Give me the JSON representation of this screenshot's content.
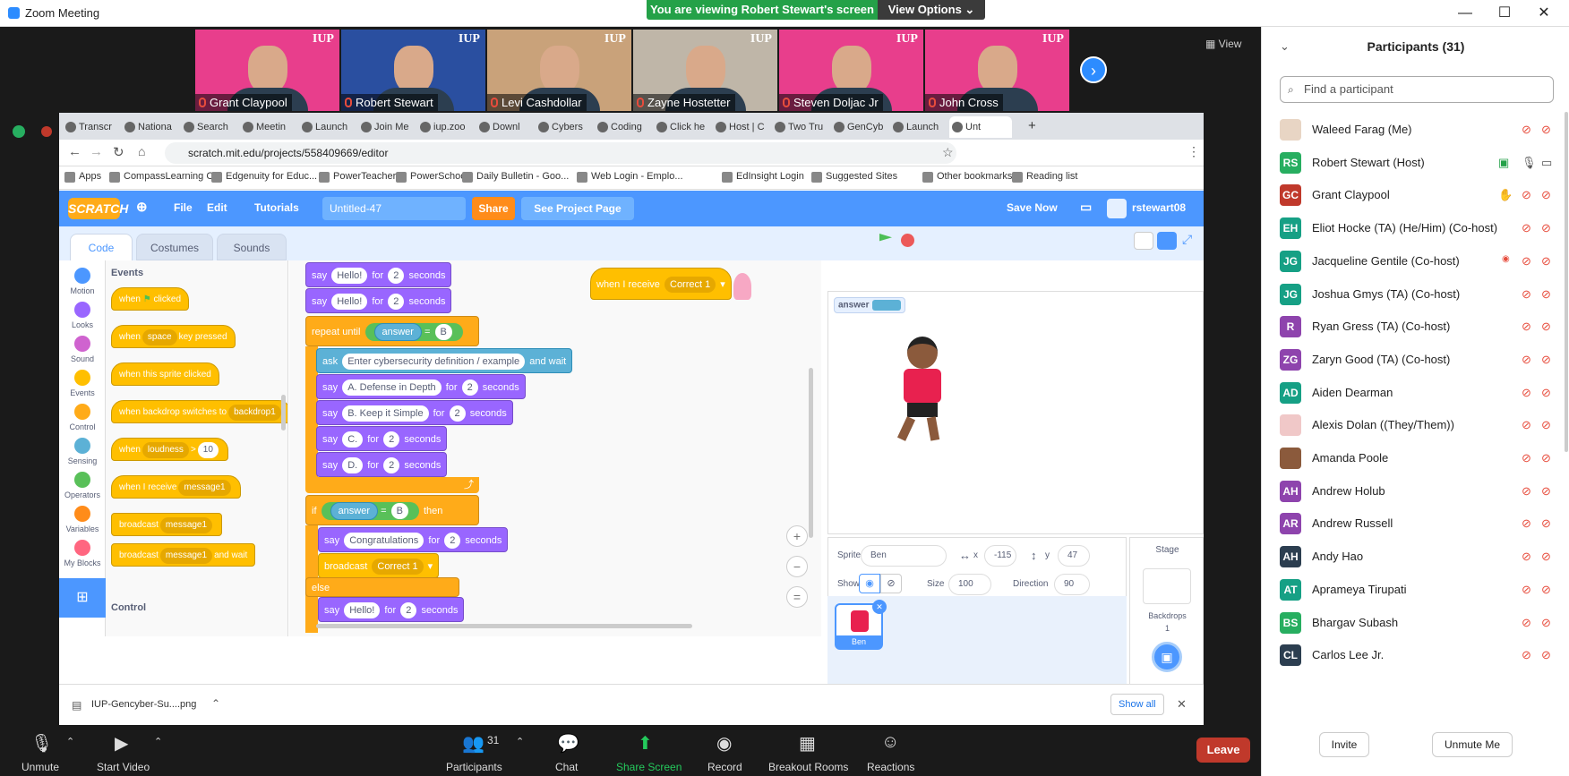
{
  "window": {
    "title": "Zoom Meeting",
    "viewing": "You are viewing Robert Stewart's screen",
    "view_options": "View Options",
    "view_label": "View"
  },
  "thumbs": [
    {
      "name": "Grant Claypool",
      "bg": "#e83e8c"
    },
    {
      "name": "Robert Stewart",
      "bg": "#2a4fa0"
    },
    {
      "name": "Levi Cashdollar",
      "bg": "#c9a27a"
    },
    {
      "name": "Zayne Hostetter",
      "bg": "#bfb6a8"
    },
    {
      "name": "Steven Doljac Jr",
      "bg": "#e83e8c"
    },
    {
      "name": "John Cross",
      "bg": "#e83e8c"
    }
  ],
  "iup": "IUP",
  "browser": {
    "tabs": [
      "Transcr",
      "Nationa",
      "Search",
      "Meetin",
      "Launch",
      "Join Me",
      "iup.zoo",
      "Downl",
      "Cybers",
      "Coding",
      "Click he",
      "Host | C",
      "Two Tru",
      "GenCyb",
      "Launch",
      "Unt"
    ],
    "url": "scratch.mit.edu/projects/558409669/editor",
    "bookmarks": [
      "Apps",
      "CompassLearning C...",
      "Edgenuity for Educ...",
      "PowerTeacher",
      "PowerSchool",
      "Daily Bulletin - Goo...",
      "Web Login - Emplo...",
      "EdInsight Login",
      "Suggested Sites",
      "Other bookmarks",
      "Reading list"
    ]
  },
  "scratch": {
    "logo": "SCRATCH",
    "file": "File",
    "edit": "Edit",
    "tutorials": "Tutorials",
    "project": "Untitled-47",
    "share": "Share",
    "see_page": "See Project Page",
    "save_now": "Save Now",
    "user": "rstewart08",
    "tabs": [
      "Code",
      "Costumes",
      "Sounds"
    ],
    "categories": [
      {
        "label": "Motion",
        "color": "#4c97ff"
      },
      {
        "label": "Looks",
        "color": "#9966ff"
      },
      {
        "label": "Sound",
        "color": "#cf63cf"
      },
      {
        "label": "Events",
        "color": "#ffbf00"
      },
      {
        "label": "Control",
        "color": "#ffab19"
      },
      {
        "label": "Sensing",
        "color": "#5cb1d6"
      },
      {
        "label": "Operators",
        "color": "#59c059"
      },
      {
        "label": "Variables",
        "color": "#ff8c1a"
      },
      {
        "label": "My Blocks",
        "color": "#ff6680"
      }
    ],
    "palette_heading": "Events",
    "palette_heading2": "Control",
    "palette": {
      "flag_a": "when",
      "flag_b": "clicked",
      "key_a": "when",
      "key_b": "space",
      "key_c": "key pressed",
      "sprite_click": "when this sprite clicked",
      "backdrop_a": "when backdrop switches to",
      "backdrop_b": "backdrop1",
      "loud_a": "when",
      "loud_b": "loudness",
      "loud_c": ">",
      "loud_d": "10",
      "recv_a": "when I receive",
      "recv_b": "message1",
      "bc_a": "broadcast",
      "bc_b": "message1",
      "bcw_a": "broadcast",
      "bcw_b": "message1",
      "bcw_c": "and wait"
    },
    "script": {
      "say": "say",
      "for": "for",
      "seconds": "seconds",
      "hello": "Hello!",
      "two": "2",
      "repeat_until": "repeat until",
      "answer": "answer",
      "eq": "=",
      "b": "B",
      "ask": "ask",
      "ask_text": "Enter cybersecurity definition / example",
      "and_wait": "and wait",
      "opt_a": "A. Defense in Depth",
      "opt_b": "B. Keep it Simple",
      "opt_c": "C.",
      "opt_d": "D.",
      "if": "if",
      "then": "then",
      "congrats": "Congratulations",
      "broadcast": "broadcast",
      "correct1": "Correct 1",
      "else": "else",
      "when_receive": "when I receive"
    },
    "monitor": "answer",
    "sprite": {
      "label": "Sprite",
      "name": "Ben",
      "x_label": "x",
      "x": "-115",
      "y_label": "y",
      "y": "47",
      "show": "Show",
      "size_label": "Size",
      "size": "100",
      "dir_label": "Direction",
      "dir": "90",
      "thumb": "Ben"
    },
    "stage": {
      "label": "Stage",
      "backdrops": "Backdrops",
      "count": "1"
    }
  },
  "download": {
    "file": "IUP-Gencyber-Su....png",
    "show_all": "Show all"
  },
  "participants": {
    "title": "Participants (31)",
    "search": "Find a participant",
    "list": [
      {
        "name": "Waleed Farag (Me)",
        "initials": "",
        "color": "#e8d5c4"
      },
      {
        "name": "Robert Stewart (Host)",
        "initials": "RS",
        "color": "#27ae60"
      },
      {
        "name": "Grant Claypool",
        "initials": "GC",
        "color": "#c0392b"
      },
      {
        "name": "Eliot Hocke (TA) (He/Him) (Co-host)",
        "initials": "EH",
        "color": "#16a085"
      },
      {
        "name": "Jacqueline Gentile (Co-host)",
        "initials": "JG",
        "color": "#16a085"
      },
      {
        "name": "Joshua Gmys (TA) (Co-host)",
        "initials": "JG",
        "color": "#16a085"
      },
      {
        "name": "Ryan Gress (TA) (Co-host)",
        "initials": "R",
        "color": "#8e44ad"
      },
      {
        "name": "Zaryn Good (TA) (Co-host)",
        "initials": "ZG",
        "color": "#8e44ad"
      },
      {
        "name": "Aiden Dearman",
        "initials": "AD",
        "color": "#16a085"
      },
      {
        "name": "Alexis Dolan ((They/Them))",
        "initials": "",
        "color": "#f0c8c8"
      },
      {
        "name": "Amanda Poole",
        "initials": "",
        "color": "#8b5a3c"
      },
      {
        "name": "Andrew Holub",
        "initials": "AH",
        "color": "#8e44ad"
      },
      {
        "name": "Andrew Russell",
        "initials": "AR",
        "color": "#8e44ad"
      },
      {
        "name": "Andy Hao",
        "initials": "AH",
        "color": "#2c3e50"
      },
      {
        "name": "Aprameya Tirupati",
        "initials": "AT",
        "color": "#16a085"
      },
      {
        "name": "Bhargav Subash",
        "initials": "BS",
        "color": "#27ae60"
      },
      {
        "name": "Carlos Lee Jr.",
        "initials": "CL",
        "color": "#2c3e50"
      }
    ],
    "invite": "Invite",
    "unmute_me": "Unmute Me"
  },
  "toolbar": {
    "unmute": "Unmute",
    "start_video": "Start Video",
    "participants": "Participants",
    "count": "31",
    "chat": "Chat",
    "share": "Share Screen",
    "record": "Record",
    "breakout": "Breakout Rooms",
    "reactions": "Reactions",
    "leave": "Leave"
  }
}
